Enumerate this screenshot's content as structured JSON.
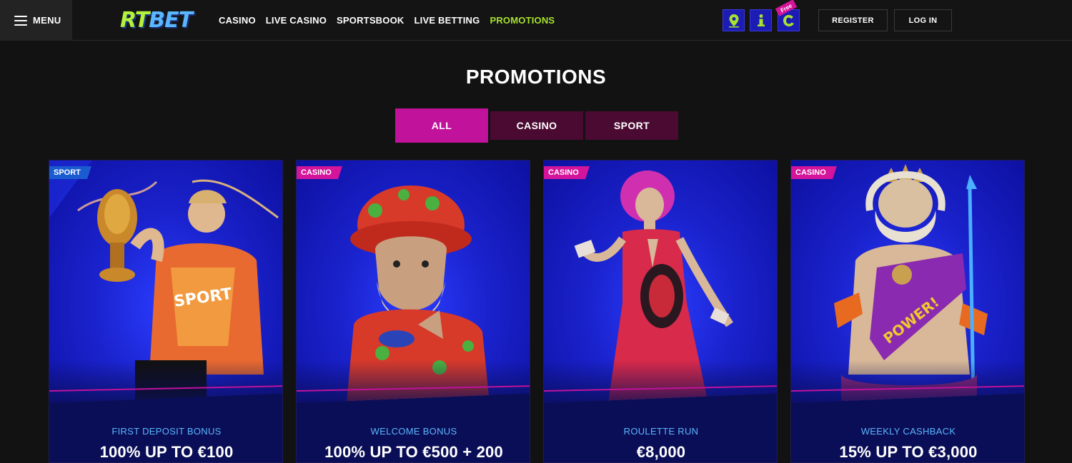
{
  "header": {
    "menu_label": "MENU",
    "logo_rt": "RT",
    "logo_bet": "BET",
    "nav": [
      "CASINO",
      "LIVE CASINO",
      "SPORTSBOOK",
      "LIVE BETTING",
      "PROMOTIONS"
    ],
    "active_nav": "PROMOTIONS",
    "free_badge": "Free",
    "register_label": "REGISTER",
    "login_label": "LOG IN",
    "icons": [
      "map-pin-icon",
      "info-icon",
      "free-spin-icon"
    ]
  },
  "page": {
    "title": "PROMOTIONS",
    "tabs": [
      "ALL",
      "CASINO",
      "SPORT"
    ],
    "active_tab": "ALL"
  },
  "cards": [
    {
      "tag": "SPORT",
      "subtitle": "FIRST DEPOSIT BONUS",
      "headline": "100% UP TO €100"
    },
    {
      "tag": "CASINO",
      "subtitle": "WELCOME BONUS",
      "headline": "100% UP TO €500 + 200"
    },
    {
      "tag": "CASINO",
      "subtitle": "ROULETTE RUN",
      "headline": "€8,000"
    },
    {
      "tag": "CASINO",
      "subtitle": "WEEKLY CASHBACK",
      "headline": "15% UP TO €3,000"
    }
  ],
  "colors": {
    "accent_green": "#a6e22e",
    "accent_pink": "#c0129a",
    "tag_blue": "#1a5ccf",
    "card_bg": "#0a0e56",
    "subtitle_blue": "#5ab7ff"
  }
}
